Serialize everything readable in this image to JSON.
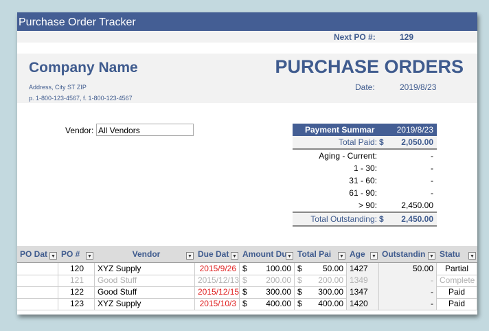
{
  "app_title": "Purchase Order Tracker",
  "next_po": {
    "label": "Next PO #:",
    "value": "129"
  },
  "company": {
    "name": "Company Name",
    "address": "Address, City ST ZIP",
    "phone": "p. 1-800-123-4567, f. 1-800-123-4567"
  },
  "doc_title": "PURCHASE ORDERS",
  "date": {
    "label": "Date:",
    "value": "2019/8/23"
  },
  "vendor_filter": {
    "label": "Vendor:",
    "value": "All Vendors"
  },
  "payment_summary": {
    "header": "Payment Summar",
    "header_date": "2019/8/23",
    "total_paid": {
      "label": "Total Paid:",
      "currency": "$",
      "value": "2,050.00"
    },
    "aging": [
      {
        "label": "Aging - Current:",
        "value": "-"
      },
      {
        "label": "1 - 30:",
        "value": "-"
      },
      {
        "label": "31 - 60:",
        "value": "-"
      },
      {
        "label": "61 - 90:",
        "value": "-"
      },
      {
        "label": "> 90:",
        "value": "2,450.00"
      }
    ],
    "total_outstanding": {
      "label": "Total Outstanding:",
      "currency": "$",
      "value": "2,450.00"
    }
  },
  "table": {
    "columns": [
      "PO Dat",
      "PO #",
      "Vendor",
      "Due Dat",
      "Amount Du",
      "Total Pai",
      "Age",
      "Outstandin",
      "Statu"
    ],
    "rows": [
      {
        "po_date": "",
        "po": "120",
        "vendor": "XYZ Supply",
        "due": "2015/9/26",
        "cur1": "$",
        "amount": "100.00",
        "cur2": "$",
        "paid": "50.00",
        "age": "1427",
        "outstanding": "50.00",
        "status": "Partial"
      },
      {
        "po_date": "",
        "po": "121",
        "vendor": "Good Stuff",
        "due": "2015/12/13",
        "cur1": "$",
        "amount": "200.00",
        "cur2": "$",
        "paid": "200.00",
        "age": "1349",
        "outstanding": "-",
        "status": "Complete"
      },
      {
        "po_date": "",
        "po": "122",
        "vendor": "Good Stuff",
        "due": "2015/12/15",
        "cur1": "$",
        "amount": "300.00",
        "cur2": "$",
        "paid": "300.00",
        "age": "1347",
        "outstanding": "-",
        "status": "Paid"
      },
      {
        "po_date": "",
        "po": "123",
        "vendor": "XYZ Supply",
        "due": "2015/10/3",
        "cur1": "$",
        "amount": "400.00",
        "cur2": "$",
        "paid": "400.00",
        "age": "1420",
        "outstanding": "-",
        "status": "Paid"
      }
    ]
  },
  "colors": {
    "accent": "#445e94",
    "overdue": "#e02020",
    "muted": "#b0b0b0"
  }
}
